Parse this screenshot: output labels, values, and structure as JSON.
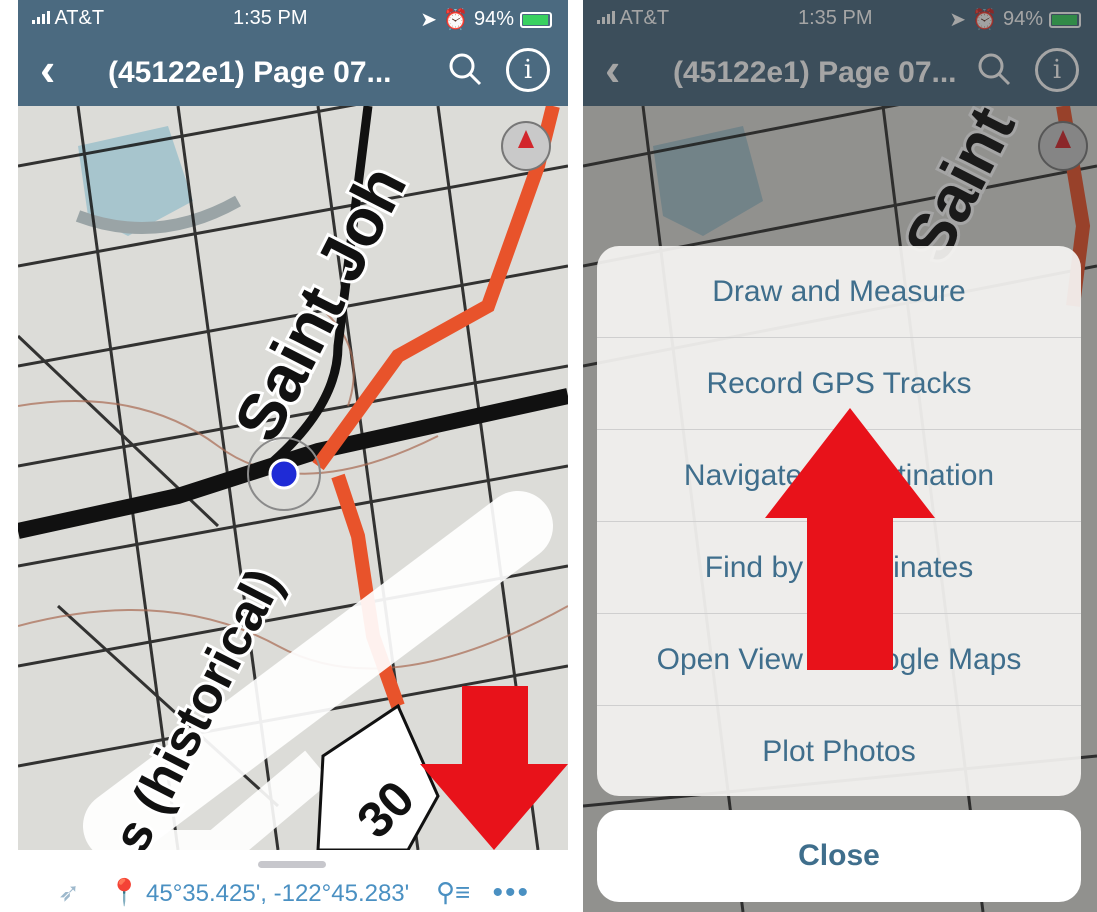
{
  "status": {
    "carrier": "AT&T",
    "time": "1:35 PM",
    "battery": "94%"
  },
  "nav": {
    "back_icon": "chevron-left",
    "title": "(45122e1) Page 07...",
    "search_icon": "magnifier",
    "info_icon": "info"
  },
  "map": {
    "labels": {
      "street": "Saint Joh",
      "historical": "s (historical)",
      "route": "30"
    },
    "colors": {
      "road": "#e8532b",
      "gps_dot": "#1f2bd6",
      "water": "#a7c5cd",
      "ink": "#151515"
    }
  },
  "bottom_bar": {
    "coordinates": "45°35.425', -122°45.283'",
    "locate_icon": "location-arrow",
    "pin_icon": "map-pin",
    "pin_list_icon": "pin-list",
    "more_label": "•••"
  },
  "action_sheet": {
    "items": [
      {
        "label": "Draw and Measure"
      },
      {
        "label": "Record GPS Tracks"
      },
      {
        "label": "Navigate to Destination"
      },
      {
        "label": "Find by Coordinates"
      },
      {
        "label": "Open View in Google Maps"
      },
      {
        "label": "Plot Photos"
      }
    ],
    "close_label": "Close"
  },
  "annotations": {
    "arrow_color": "#e8121a"
  }
}
